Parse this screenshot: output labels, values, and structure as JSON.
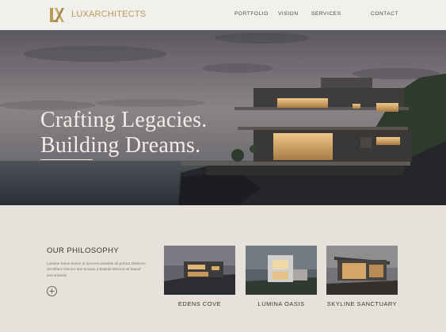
{
  "header": {
    "brand": "LUXARCHITECTS",
    "logo_icon": "lx-monogram-logo",
    "accent_color": "#b99a56",
    "nav": [
      "PORTFOLIO",
      "VISION",
      "SERVICES",
      "CONTACT"
    ]
  },
  "hero": {
    "headline_line1": "Crafting Legacies.",
    "headline_line2": "Building Dreams."
  },
  "philosophy": {
    "title": "OUR PHILOSOPHY",
    "text": "Lumene toune domm ul syvnces possible dit prrbics Dielenne demithem lewnics deo bnsaux a basbds Morcnd ad beaud ana kmbrals",
    "button_icon": "circle-plus-icon"
  },
  "projects": [
    {
      "name": "EDENS COVE"
    },
    {
      "name": "LUMINA OASIS"
    },
    {
      "name": "SKYLINE SANCTUARY"
    }
  ]
}
